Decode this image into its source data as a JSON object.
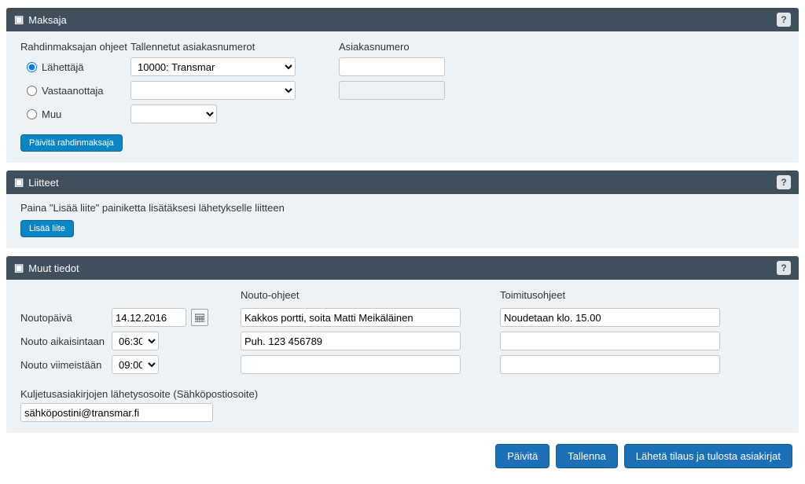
{
  "payer": {
    "title": "Maksaja",
    "instructions_label": "Rahdinmaksajan ohjeet",
    "saved_label": "Tallennetut asiakasnumerot",
    "cust_label": "Asiakasnumero",
    "options": {
      "sender": "Lähettäjä",
      "receiver": "Vastaanottaja",
      "other": "Muu"
    },
    "saved_value": "10000: Transmar",
    "cust_value": "",
    "update_btn": "Päivitä rahdinmaksaja",
    "help": "?"
  },
  "attach": {
    "title": "Liitteet",
    "hint": "Paina \"Lisää liite\" painiketta lisätäksesi lähetykselle liitteen",
    "add_btn": "Lisää liite",
    "help": "?"
  },
  "muut": {
    "title": "Muut tiedot",
    "help": "?",
    "left": {
      "pickup_day": "Noutopäivä",
      "pickup_date": "14.12.2016",
      "earliest_label": "Nouto aikaisintaan",
      "earliest_val": "06:30",
      "latest_label": "Nouto viimeistään",
      "latest_val": "09:00"
    },
    "mid": {
      "label": "Nouto-ohjeet",
      "line1": "Kakkos portti, soita Matti Meikäläinen",
      "line2": "Puh. 123 456789",
      "line3": ""
    },
    "right": {
      "label": "Toimitusohjeet",
      "line1": "Noudetaan klo. 15.00",
      "line2": "",
      "line3": ""
    },
    "email_label": "Kuljetusasiakirjojen lähetysosoite  (Sähköpostiosoite)",
    "email_value": "sähköpostini@transmar.fi"
  },
  "footer": {
    "refresh": "Päivitä",
    "save": "Tallenna",
    "send": "Lähetä tilaus ja tulosta asiakirjat"
  }
}
